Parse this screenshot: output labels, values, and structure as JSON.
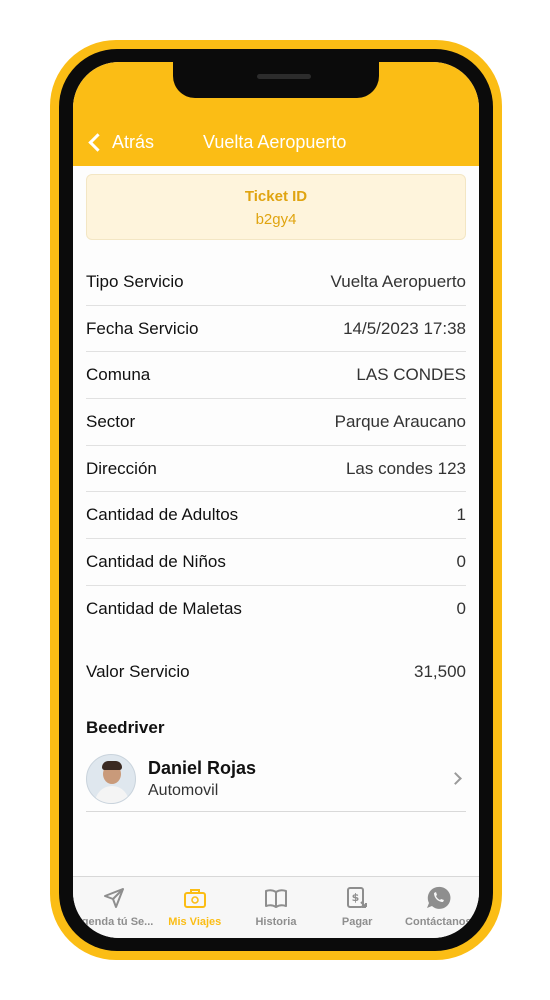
{
  "header": {
    "back_label": "Atrás",
    "title": "Vuelta Aeropuerto"
  },
  "ticket": {
    "label": "Ticket ID",
    "value": "b2gy4"
  },
  "details": [
    {
      "label": "Tipo Servicio",
      "value": "Vuelta Aeropuerto"
    },
    {
      "label": "Fecha Servicio",
      "value": "14/5/2023 17:38"
    },
    {
      "label": "Comuna",
      "value": "LAS CONDES"
    },
    {
      "label": "Sector",
      "value": "Parque Araucano"
    },
    {
      "label": "Dirección",
      "value": "Las condes 123"
    },
    {
      "label": "Cantidad de Adultos",
      "value": "1"
    },
    {
      "label": "Cantidad de Niños",
      "value": "0"
    },
    {
      "label": "Cantidad de Maletas",
      "value": "0"
    }
  ],
  "valor": {
    "label": "Valor Servicio",
    "value": "31,500"
  },
  "driver": {
    "heading": "Beedriver",
    "name": "Daniel Rojas",
    "vehicle": "Automovil"
  },
  "tabs": [
    {
      "label": "Agenda tú Se...",
      "icon": "send-icon"
    },
    {
      "label": "Mis Viajes",
      "icon": "suitcase-icon",
      "active": true
    },
    {
      "label": "Historia",
      "icon": "book-icon"
    },
    {
      "label": "Pagar",
      "icon": "payment-icon"
    },
    {
      "label": "Contáctanos",
      "icon": "whatsapp-icon"
    }
  ],
  "colors": {
    "accent": "#fbbd15",
    "ticket_text": "#e0a410",
    "ticket_bg": "#fef4dc",
    "tab_inactive": "#8e8e8e"
  }
}
